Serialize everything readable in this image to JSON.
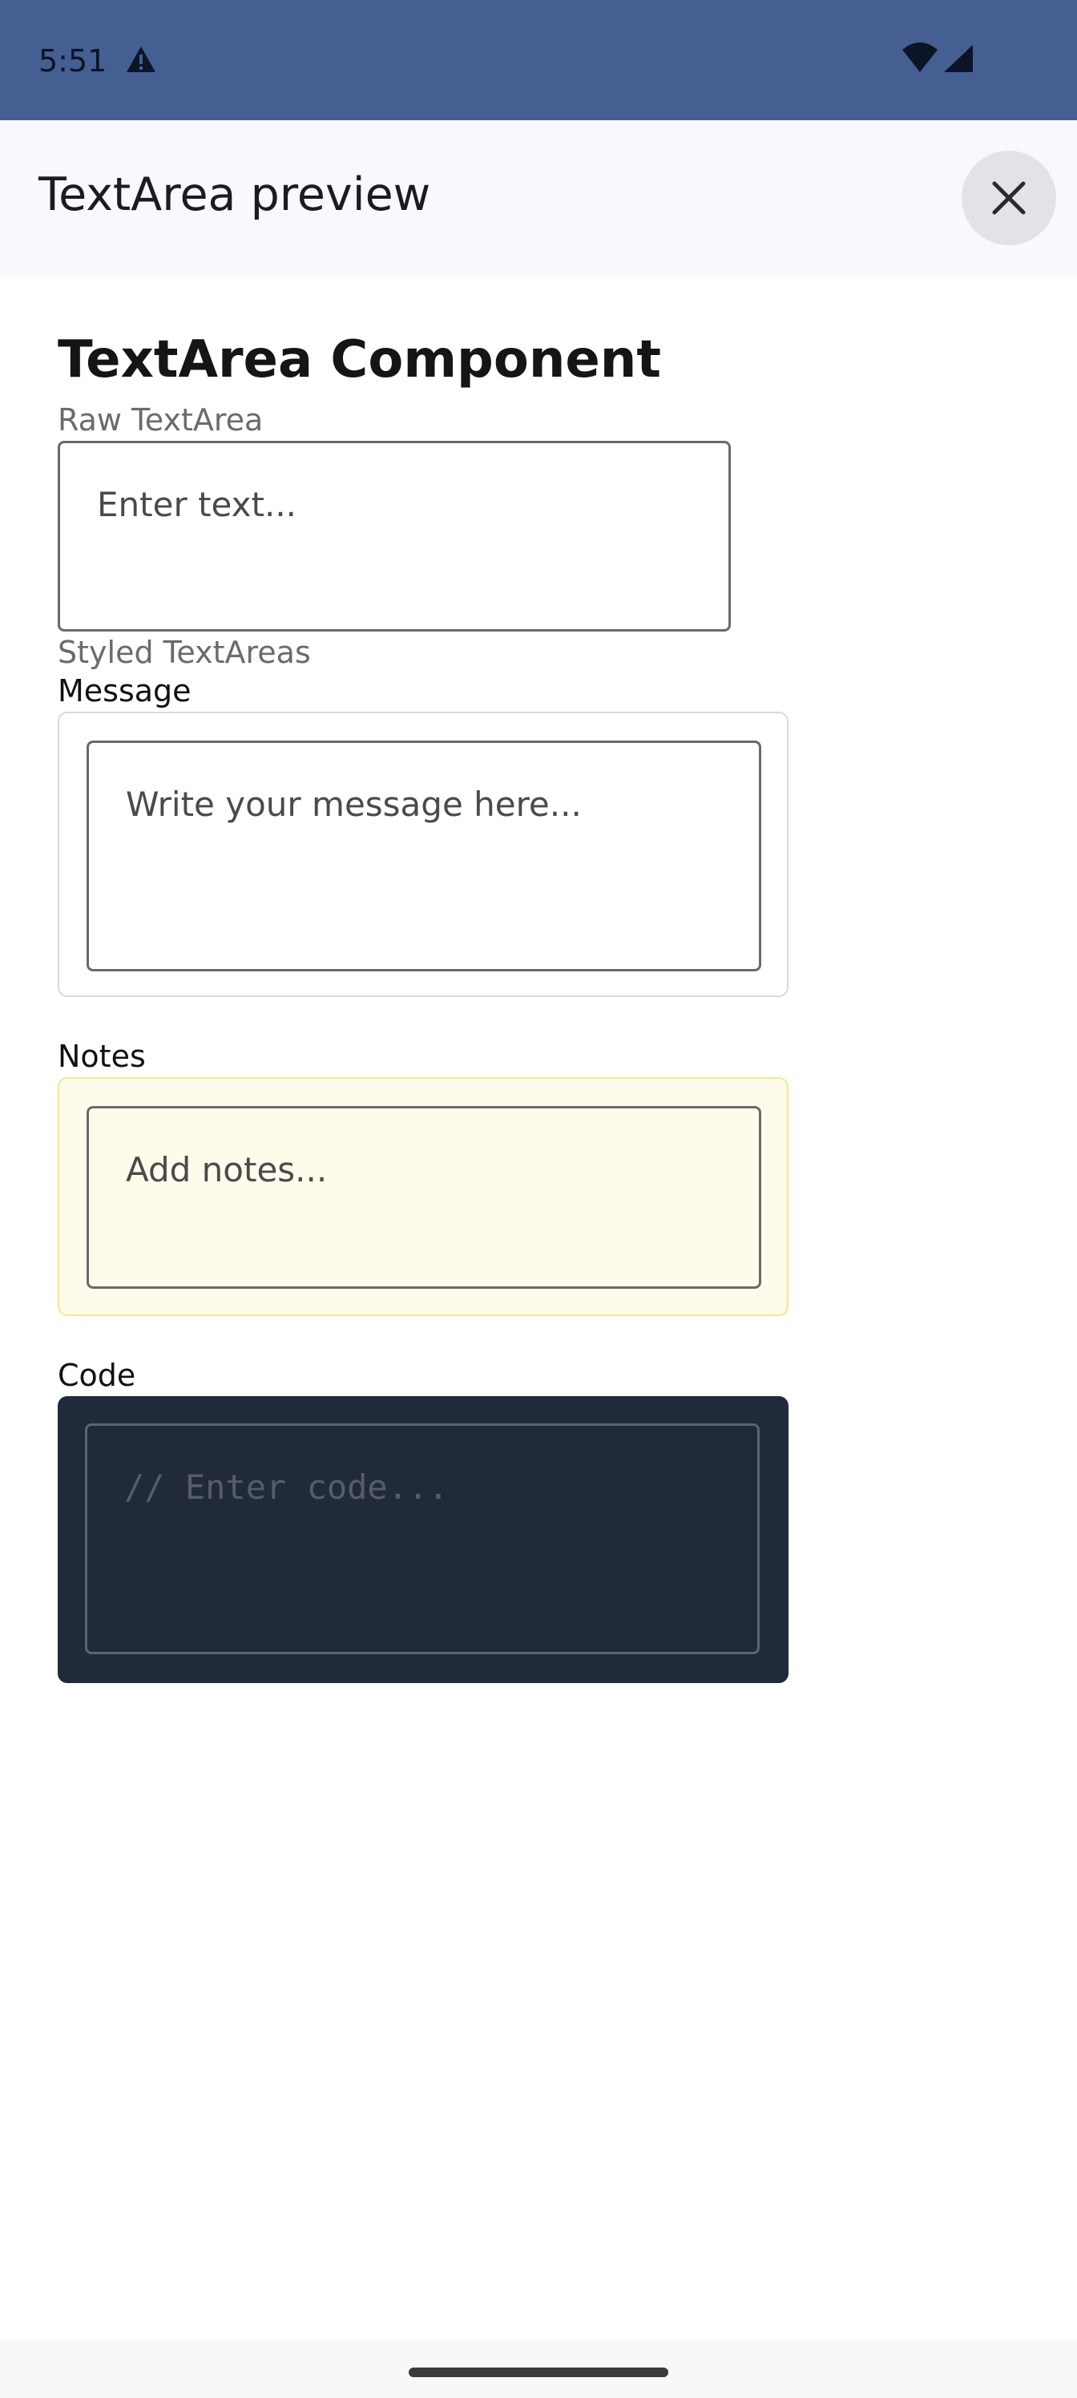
{
  "status_bar": {
    "time": "5:51",
    "icons": [
      "warning-icon",
      "wifi-icon",
      "signal-icon"
    ]
  },
  "app_bar": {
    "title": "TextArea preview",
    "close_icon": "close-icon"
  },
  "content": {
    "heading": "TextArea Component",
    "raw_section_label": "Raw TextArea",
    "raw_textarea": {
      "placeholder": "Enter text...",
      "value": ""
    },
    "styled_section_label": "Styled TextAreas",
    "message": {
      "label": "Message",
      "placeholder": "Write your message here...",
      "value": ""
    },
    "notes": {
      "label": "Notes",
      "placeholder": "Add notes...",
      "value": ""
    },
    "code": {
      "label": "Code",
      "placeholder": "// Enter code...",
      "value": ""
    }
  },
  "colors": {
    "status_bar": "#455f93",
    "app_bar": "#f8f8fd",
    "notes_bg": "#fefbea",
    "notes_border": "#f7e58d",
    "code_bg": "#212a3a"
  }
}
